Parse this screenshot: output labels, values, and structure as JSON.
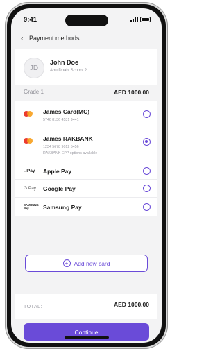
{
  "status_bar": {
    "time": "9:41"
  },
  "header": {
    "title": "Payment methods"
  },
  "user": {
    "initials": "JD",
    "name": "John Doe",
    "school": "Abu Dhabi School 2"
  },
  "grade": {
    "label": "Grade 1",
    "amount": "AED 1000.00"
  },
  "payment_methods": [
    {
      "title": "James Card(MC)",
      "sub1": "5746 8136 4531 9441",
      "sub2": "",
      "icon": "mastercard-icon",
      "selected": false
    },
    {
      "title": "James RAKBANK",
      "sub1": "1234 5678 9012 5456",
      "sub2": "RAKBANK EPP options available",
      "icon": "mastercard-icon",
      "selected": true
    },
    {
      "title": "Apple Pay",
      "icon_text": "Pay",
      "icon": "apple-pay-icon",
      "selected": false
    },
    {
      "title": "Google Pay",
      "icon_text": "G Pay",
      "icon": "google-pay-icon",
      "selected": false
    },
    {
      "title": "Samsung Pay",
      "icon_text": "SAMSUNG Pay",
      "icon": "samsung-pay-icon",
      "selected": false
    }
  ],
  "add_card_label": "Add new card",
  "total": {
    "label": "TOTAL:",
    "amount": "AED 1000.00"
  },
  "continue_label": "Continue",
  "colors": {
    "accent": "#6a4bd8",
    "background": "#f3f3f4"
  }
}
